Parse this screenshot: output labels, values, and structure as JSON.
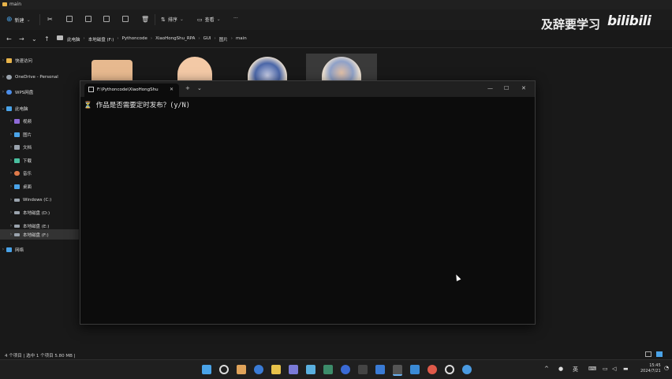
{
  "window": {
    "title": "main"
  },
  "toolbar": {
    "new_label": "新建",
    "sort_label": "排序",
    "view_label": "查看",
    "more_label": "···"
  },
  "watermark": {
    "text": "及辞要学习",
    "logo": "bilibili"
  },
  "breadcrumbs": [
    "此电脑",
    "本地磁盘 (F:)",
    "Pythoncode",
    "XiaoHongShu_RPA",
    "GUI",
    "图片",
    "main"
  ],
  "sidebar": {
    "items": [
      {
        "label": "快速访问",
        "icon": "star-icon",
        "color": "#e8b44a"
      },
      {
        "label": "OneDrive - Personal",
        "icon": "cloud-icon",
        "color": "#9aa3ad"
      },
      {
        "label": "WPS网盘",
        "icon": "cloud-icon",
        "color": "#4c8de8"
      },
      {
        "label": "此电脑",
        "icon": "pc-icon",
        "color": "#4aa3e8"
      },
      {
        "label": "视频",
        "icon": "video-icon",
        "color": "#8f6ad8"
      },
      {
        "label": "图片",
        "icon": "image-icon",
        "color": "#4aa3e8"
      },
      {
        "label": "文档",
        "icon": "document-icon",
        "color": "#9aa3ad"
      },
      {
        "label": "下载",
        "icon": "download-icon",
        "color": "#4ac0a0"
      },
      {
        "label": "音乐",
        "icon": "music-icon",
        "color": "#e07a4a"
      },
      {
        "label": "桌面",
        "icon": "desktop-icon",
        "color": "#4aa3e8"
      },
      {
        "label": "Windows (C:)",
        "icon": "drive-icon",
        "color": "#9aa3ad"
      },
      {
        "label": "本地磁盘 (D:)",
        "icon": "drive-icon",
        "color": "#9aa3ad"
      },
      {
        "label": "本地磁盘 (E:)",
        "icon": "drive-icon",
        "color": "#9aa3ad"
      },
      {
        "label": "本地磁盘 (F:)",
        "icon": "drive-icon",
        "color": "#9aa3ad"
      },
      {
        "label": "网络",
        "icon": "network-icon",
        "color": "#4aa3e8"
      }
    ]
  },
  "terminal": {
    "tab_title": "F:\\Pythoncode\\XiaoHongShu",
    "new_tab": "+",
    "dropdown": "⌄",
    "minimize": "—",
    "maximize": "☐",
    "close": "✕",
    "prompt_icon": "⏳",
    "prompt_text": "作品是否需要定时发布？(y/N)"
  },
  "statusbar": {
    "text": "4 个项目 | 选中 1 个项目 5.80 MB |"
  },
  "tray": {
    "lang": "英",
    "time": "15:45",
    "date": "2024/7/21"
  }
}
